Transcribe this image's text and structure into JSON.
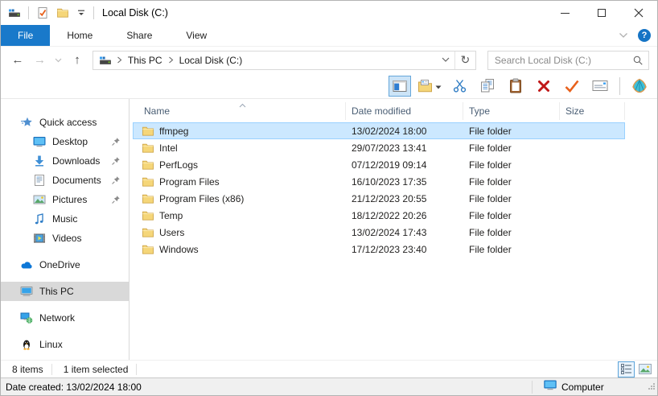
{
  "window": {
    "title": "Local Disk (C:)"
  },
  "ribbon": {
    "tabs": [
      {
        "label": "File",
        "active": true
      },
      {
        "label": "Home",
        "active": false
      },
      {
        "label": "Share",
        "active": false
      },
      {
        "label": "View",
        "active": false
      }
    ],
    "help_glyph": "?"
  },
  "navbar": {
    "breadcrumb": [
      {
        "label": "This PC"
      },
      {
        "label": "Local Disk (C:)"
      }
    ],
    "search_placeholder": "Search Local Disk (C:)"
  },
  "toolbar": {
    "buttons": [
      {
        "name": "navigation-pane-toggle-button",
        "icon": "nav-pane-icon",
        "active": true
      },
      {
        "name": "folder-options-button",
        "icon": "folder-options-icon",
        "caret": true
      },
      {
        "name": "cut-button",
        "icon": "cut-icon"
      },
      {
        "name": "copy-button",
        "icon": "copy-icon"
      },
      {
        "name": "paste-button",
        "icon": "paste-icon"
      },
      {
        "name": "delete-button",
        "icon": "delete-icon"
      },
      {
        "name": "select-button",
        "icon": "checkmark-icon"
      },
      {
        "name": "rename-button",
        "icon": "rename-icon"
      },
      {
        "name": "toolbar-separator",
        "separator": true
      },
      {
        "name": "shell-button",
        "icon": "shell-icon"
      }
    ]
  },
  "sidebar": {
    "items": [
      {
        "label": "Quick access",
        "icon": "quick-access-icon",
        "indent": 0,
        "pinned": false,
        "selected": false,
        "group_start": false
      },
      {
        "label": "Desktop",
        "icon": "desktop-icon",
        "indent": 1,
        "pinned": true,
        "selected": false,
        "group_start": false
      },
      {
        "label": "Downloads",
        "icon": "downloads-icon",
        "indent": 1,
        "pinned": true,
        "selected": false,
        "group_start": false
      },
      {
        "label": "Documents",
        "icon": "documents-icon",
        "indent": 1,
        "pinned": true,
        "selected": false,
        "group_start": false
      },
      {
        "label": "Pictures",
        "icon": "pictures-icon",
        "indent": 1,
        "pinned": true,
        "selected": false,
        "group_start": false
      },
      {
        "label": "Music",
        "icon": "music-icon",
        "indent": 1,
        "pinned": false,
        "selected": false,
        "group_start": false
      },
      {
        "label": "Videos",
        "icon": "videos-icon",
        "indent": 1,
        "pinned": false,
        "selected": false,
        "group_start": false
      },
      {
        "label": "OneDrive",
        "icon": "onedrive-icon",
        "indent": 0,
        "pinned": false,
        "selected": false,
        "group_start": true
      },
      {
        "label": "This PC",
        "icon": "this-pc-icon",
        "indent": 0,
        "pinned": false,
        "selected": true,
        "group_start": true
      },
      {
        "label": "Network",
        "icon": "network-icon",
        "indent": 0,
        "pinned": false,
        "selected": false,
        "group_start": true
      },
      {
        "label": "Linux",
        "icon": "linux-icon",
        "indent": 0,
        "pinned": false,
        "selected": false,
        "group_start": true
      }
    ]
  },
  "filelist": {
    "columns": [
      {
        "label": "Name",
        "sort": "asc"
      },
      {
        "label": "Date modified",
        "sort": ""
      },
      {
        "label": "Type",
        "sort": ""
      },
      {
        "label": "Size",
        "sort": ""
      }
    ],
    "rows": [
      {
        "name": "ffmpeg",
        "date_modified": "13/02/2024 18:00",
        "type": "File folder",
        "size": "",
        "selected": true
      },
      {
        "name": "Intel",
        "date_modified": "29/07/2023 13:41",
        "type": "File folder",
        "size": "",
        "selected": false
      },
      {
        "name": "PerfLogs",
        "date_modified": "07/12/2019 09:14",
        "type": "File folder",
        "size": "",
        "selected": false
      },
      {
        "name": "Program Files",
        "date_modified": "16/10/2023 17:35",
        "type": "File folder",
        "size": "",
        "selected": false
      },
      {
        "name": "Program Files (x86)",
        "date_modified": "21/12/2023 20:55",
        "type": "File folder",
        "size": "",
        "selected": false
      },
      {
        "name": "Temp",
        "date_modified": "18/12/2022 20:26",
        "type": "File folder",
        "size": "",
        "selected": false
      },
      {
        "name": "Users",
        "date_modified": "13/02/2024 17:43",
        "type": "File folder",
        "size": "",
        "selected": false
      },
      {
        "name": "Windows",
        "date_modified": "17/12/2023 23:40",
        "type": "File folder",
        "size": "",
        "selected": false
      }
    ]
  },
  "statusbar": {
    "item_count": "8 items",
    "selection": "1 item selected"
  },
  "bottombar": {
    "date_created": "Date created: 13/02/2024 18:00",
    "location": "Computer"
  }
}
